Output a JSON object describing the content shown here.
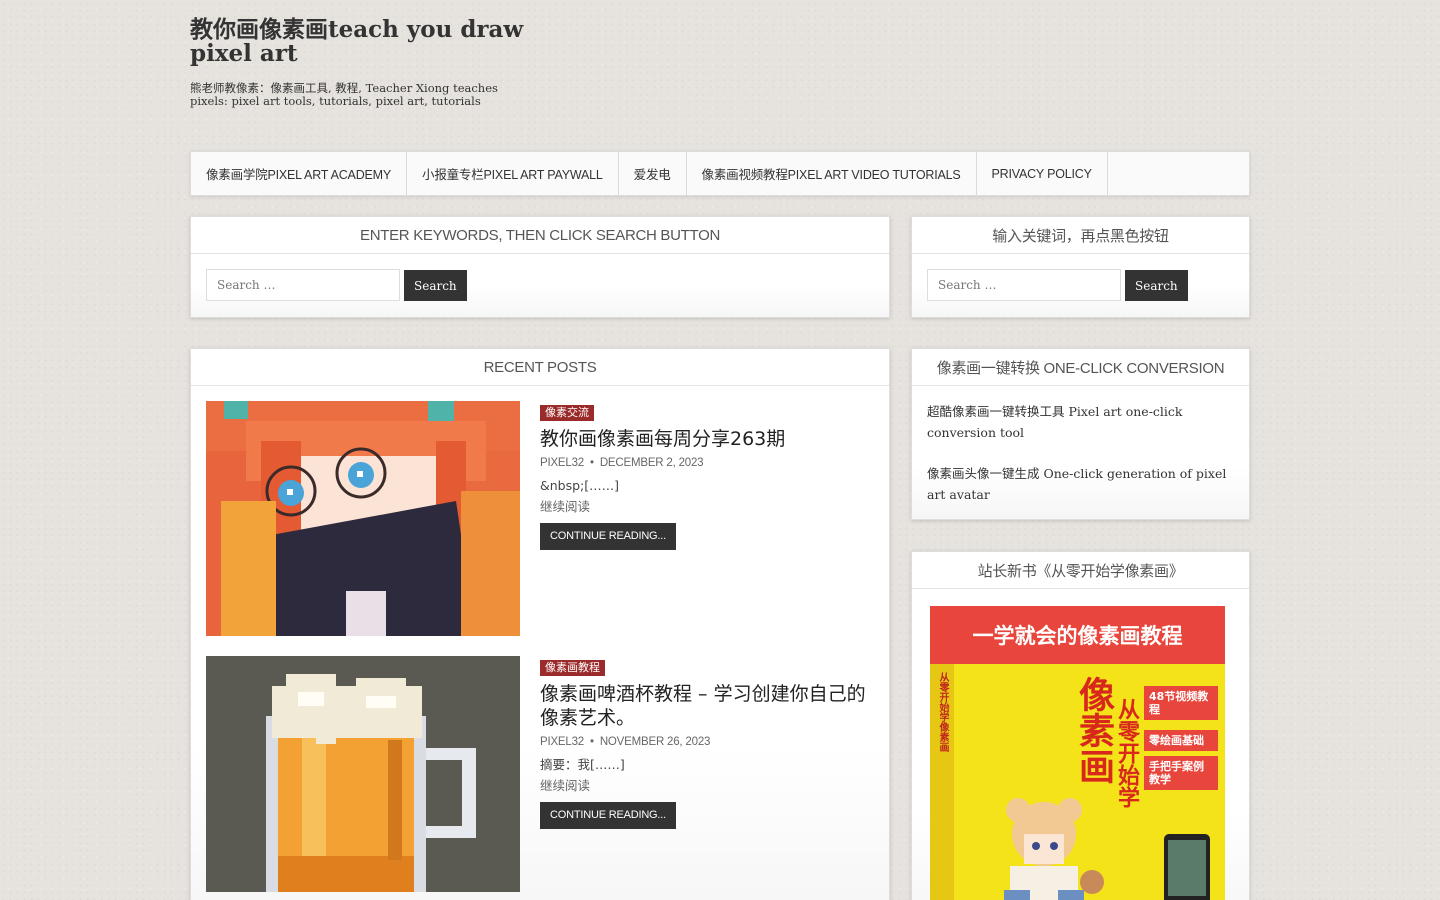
{
  "site": {
    "title": "教你画像素画teach you draw pixel art",
    "tagline": "熊老师教像素：像素画工具, 教程, Teacher Xiong teaches pixels: pixel art tools, tutorials, pixel art, tutorials"
  },
  "nav": {
    "items": [
      {
        "label": "像素画学院PIXEL ART ACADEMY"
      },
      {
        "label": "小报童专栏PIXEL ART PAYWALL"
      },
      {
        "label": "爱发电"
      },
      {
        "label": "像素画视频教程PIXEL ART VIDEO TUTORIALS"
      },
      {
        "label": "PRIVACY POLICY"
      }
    ]
  },
  "search_main": {
    "heading": "ENTER KEYWORDS, THEN CLICK SEARCH BUTTON",
    "placeholder": "Search …",
    "button": "Search"
  },
  "search_side": {
    "heading": "输入关键词，再点黑色按钮",
    "placeholder": "Search …",
    "button": "Search"
  },
  "recent": {
    "heading": "RECENT POSTS",
    "posts": [
      {
        "category": "像素交流",
        "title": "教你画像素画每周分享263期",
        "author": "PIXEL32",
        "date": "DECEMBER 2, 2023",
        "excerpt": "&nbsp;[……]",
        "read_more": "继续阅读",
        "button": "CONTINUE READING..."
      },
      {
        "category": "像素画教程",
        "title": "像素画啤酒杯教程 – 学习创建你自己的像素艺术。",
        "author": "PIXEL32",
        "date": "NOVEMBER 26, 2023",
        "excerpt": "摘要：我[……]",
        "read_more": "继续阅读",
        "button": "CONTINUE READING..."
      }
    ]
  },
  "conversion": {
    "heading": "像素画一键转换 ONE-CLICK CONVERSION",
    "links": [
      "超酷像素画一键转换工具 Pixel art one-click conversion tool",
      "像素画头像一键生成 One-click generation of pixel art avatar"
    ]
  },
  "book": {
    "heading": "站长新书《从零开始学像素画》",
    "cover_title": "一学就会的像素画教程",
    "cover_big": "像素画",
    "cover_sub": "从零开始学",
    "spine": "从零开始学像素画",
    "features": [
      "48节视频教程",
      "零绘画基础",
      "手把手案例教学"
    ]
  },
  "colors": {
    "category_badge": "#9b2b2b",
    "dark_button": "#333333",
    "book_red": "#e8453c",
    "book_yellow": "#f5e31a"
  }
}
